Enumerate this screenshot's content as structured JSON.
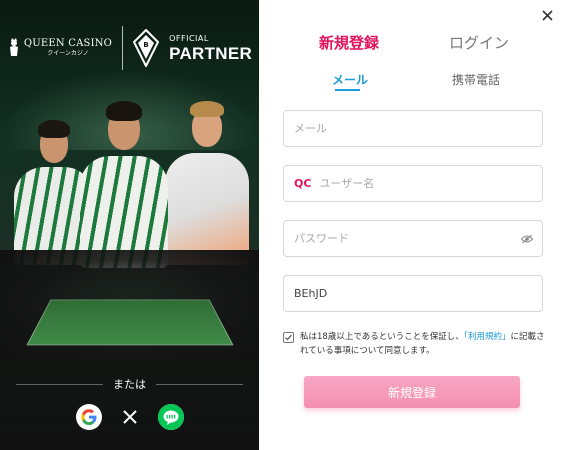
{
  "branding": {
    "casino_name": "QUEEN CASINO",
    "casino_kana": "クイーンカジノ",
    "official_label": "OFFICIAL",
    "partner_label": "PARTNER"
  },
  "social": {
    "divider_text": "または",
    "buttons": [
      {
        "name": "google",
        "icon": "google-icon"
      },
      {
        "name": "x",
        "icon": "x-icon"
      },
      {
        "name": "line",
        "icon": "line-icon"
      }
    ]
  },
  "tabs": {
    "signup": "新規登録",
    "login": "ログイン",
    "active": "signup"
  },
  "subtabs": {
    "email": "メール",
    "phone": "携帯電話",
    "active": "email"
  },
  "form": {
    "email_placeholder": "メール",
    "username_prefix": "QC",
    "username_placeholder": "ユーザー名",
    "password_placeholder": "パスワード",
    "captcha_value": "BEhJD"
  },
  "agreement": {
    "text_before": "私は18歳以上であるということを保証し、",
    "link_text": "「利用規約」",
    "text_after": "に記載されている事項について同意します。",
    "checked": true
  },
  "submit_label": "新規登録",
  "colors": {
    "brand_pink": "#e3125d",
    "accent_blue": "#1a9cd8",
    "button_pink": "#f58fb2"
  }
}
